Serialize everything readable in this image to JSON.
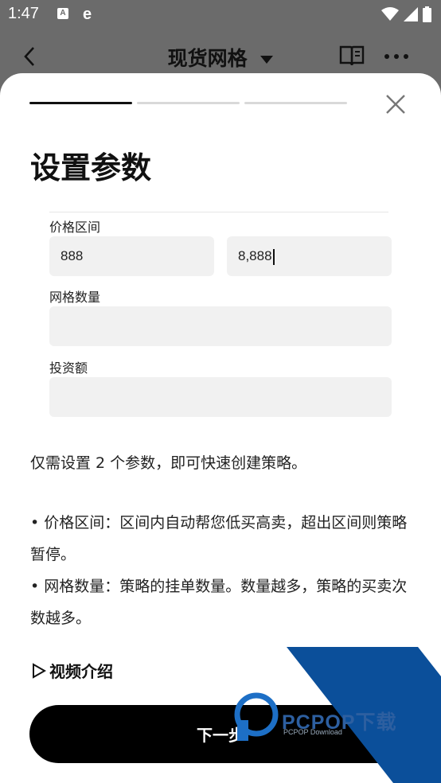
{
  "status_bar": {
    "time": "1:47",
    "icon_a_label": "A",
    "icon_e_label": "e",
    "icons": [
      "wifi-icon",
      "signal-icon",
      "battery-icon"
    ]
  },
  "header": {
    "title": "现货网格",
    "icons": [
      "back-icon",
      "caret-down-icon",
      "book-icon",
      "more-icon"
    ]
  },
  "sheet": {
    "progress_steps": 3,
    "active_step": 1,
    "title": "设置参数",
    "form": {
      "price_range_label": "价格区间",
      "price_low_value": "888",
      "price_high_value": "8,888",
      "grid_count_label": "网格数量",
      "grid_count_value": "",
      "investment_label": "投资额",
      "investment_value": ""
    },
    "description": "仅需设置 2 个参数，即可快速创建策略。",
    "bullets": [
      "• 价格区间：区间内自动帮您低买高卖，超出区间则策略暂停。",
      "• 网格数量：策略的挂单数量。数量越多，策略的买卖次数越多。"
    ],
    "video_link": "视频介绍",
    "next_button": "下一步"
  },
  "watermark": {
    "brand": "PCPOP下载",
    "sub": "PCPOP Download"
  },
  "colors": {
    "overlay": "#6b6b6b",
    "input_bg": "#f1f1f1",
    "button": "#000000",
    "watermark_blue": "#0b4f9a"
  }
}
